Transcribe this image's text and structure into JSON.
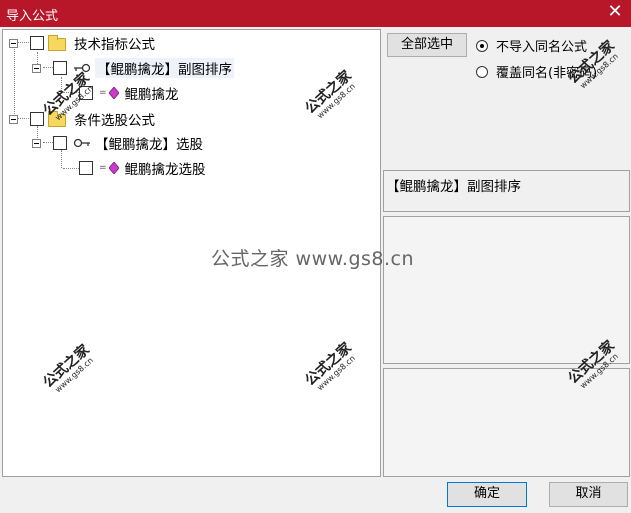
{
  "window": {
    "title": "导入公式",
    "close_glyph": "✕"
  },
  "tree": {
    "groups": [
      {
        "label": "技术指标公式",
        "children": [
          {
            "label": "【鲲鹏擒龙】副图排序",
            "children": [
              {
                "label": "鲲鹏擒龙"
              }
            ]
          }
        ]
      },
      {
        "label": "条件选股公式",
        "children": [
          {
            "label": "【鲲鹏擒龙】选股",
            "children": [
              {
                "label": "鲲鹏擒龙选股"
              }
            ]
          }
        ]
      }
    ]
  },
  "right": {
    "select_all_label": "全部选中",
    "radio_options": [
      {
        "label": "不导入同名公式",
        "selected": true
      },
      {
        "label": "覆盖同名(非密码)",
        "selected": false
      }
    ],
    "description_title": "【鲲鹏擒龙】副图排序"
  },
  "footer": {
    "ok_label": "确定",
    "cancel_label": "取消"
  },
  "watermark": {
    "brand": "公式之家",
    "url": "www.gs8.cn",
    "center_text": "公式之家 www.gs8.cn"
  },
  "colors": {
    "titlebar": "#b8172a",
    "gem": "#c83cc8",
    "folder": "#f6d860"
  },
  "icons": [
    "folder-icon",
    "gem-icon",
    "key-icon",
    "close-icon"
  ]
}
